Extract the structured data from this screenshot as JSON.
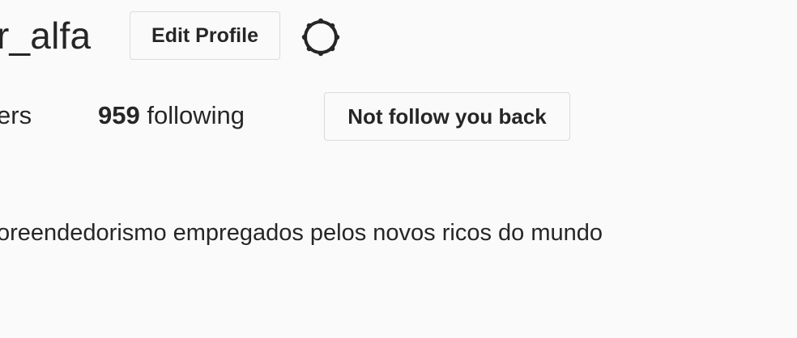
{
  "profile": {
    "username": "r_alfa",
    "edit_label": "Edit Profile",
    "settings_icon": "gear-icon"
  },
  "stats": {
    "followers_label": "ers",
    "following_count": "959",
    "following_label": "following"
  },
  "actions": {
    "not_follow_back_label": "Not follow you back"
  },
  "bio": {
    "text": "oreendedorismo empregados pelos novos ricos do mundo"
  }
}
